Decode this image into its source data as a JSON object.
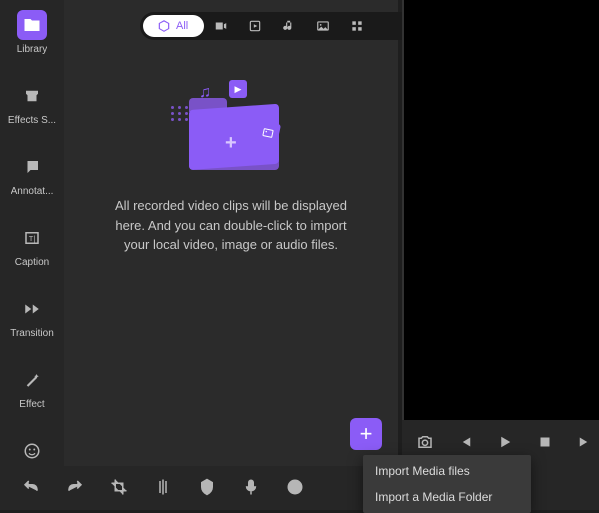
{
  "sidebar": {
    "items": [
      {
        "label": "Library"
      },
      {
        "label": "Effects S..."
      },
      {
        "label": "Annotat..."
      },
      {
        "label": "Caption"
      },
      {
        "label": "Transition"
      },
      {
        "label": "Effect"
      },
      {
        "label": "Sticker"
      }
    ]
  },
  "filters": {
    "all_label": "All"
  },
  "empty_state": {
    "message": "All recorded video clips will be displayed here. And you can double-click to import your local video, image or audio files."
  },
  "add_button": {
    "glyph": "+"
  },
  "context_menu": {
    "items": [
      {
        "label": "Import Media files"
      },
      {
        "label": "Import a Media Folder"
      }
    ]
  },
  "colors": {
    "accent": "#8b5cf6",
    "panel": "#2b2b2b",
    "sidebar": "#262626"
  }
}
